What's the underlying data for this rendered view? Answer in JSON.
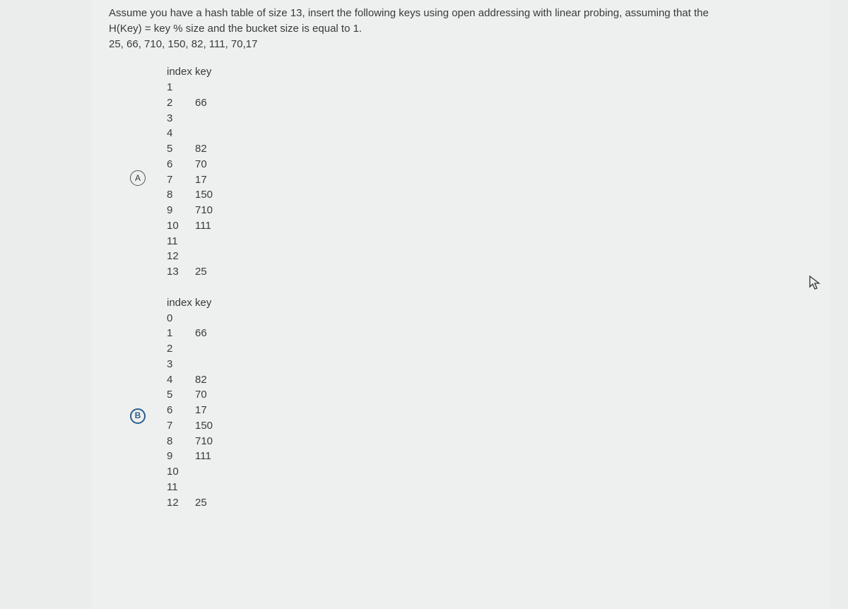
{
  "question": {
    "line1": "Assume you have a hash table of size 13, insert the following keys using open addressing with linear probing, assuming that the",
    "line2": "H(Key) = key % size and the bucket size is equal to 1.",
    "line3": "25, 66, 710, 150, 82, 111, 70,17"
  },
  "headers": {
    "index": "index",
    "key": "key"
  },
  "options": [
    {
      "label": "A",
      "selected": false,
      "rows": [
        {
          "index": "1",
          "key": ""
        },
        {
          "index": "2",
          "key": "66"
        },
        {
          "index": "3",
          "key": ""
        },
        {
          "index": "4",
          "key": ""
        },
        {
          "index": "5",
          "key": "82"
        },
        {
          "index": "6",
          "key": "70"
        },
        {
          "index": "7",
          "key": "17"
        },
        {
          "index": "8",
          "key": "150"
        },
        {
          "index": "9",
          "key": " 710"
        },
        {
          "index": "10",
          "key": "111"
        },
        {
          "index": "11",
          "key": ""
        },
        {
          "index": "12",
          "key": ""
        },
        {
          "index": "13",
          "key": "25"
        }
      ]
    },
    {
      "label": "B",
      "selected": true,
      "rows": [
        {
          "index": "0",
          "key": ""
        },
        {
          "index": "1",
          "key": "66"
        },
        {
          "index": "2",
          "key": ""
        },
        {
          "index": "3",
          "key": ""
        },
        {
          "index": "4",
          "key": "82"
        },
        {
          "index": "5",
          "key": "70"
        },
        {
          "index": "6",
          "key": "17"
        },
        {
          "index": "7",
          "key": "150"
        },
        {
          "index": "8",
          "key": "710"
        },
        {
          "index": "9",
          "key": "111"
        },
        {
          "index": "10",
          "key": ""
        },
        {
          "index": "11",
          "key": ""
        },
        {
          "index": "12",
          "key": "25"
        }
      ]
    }
  ]
}
